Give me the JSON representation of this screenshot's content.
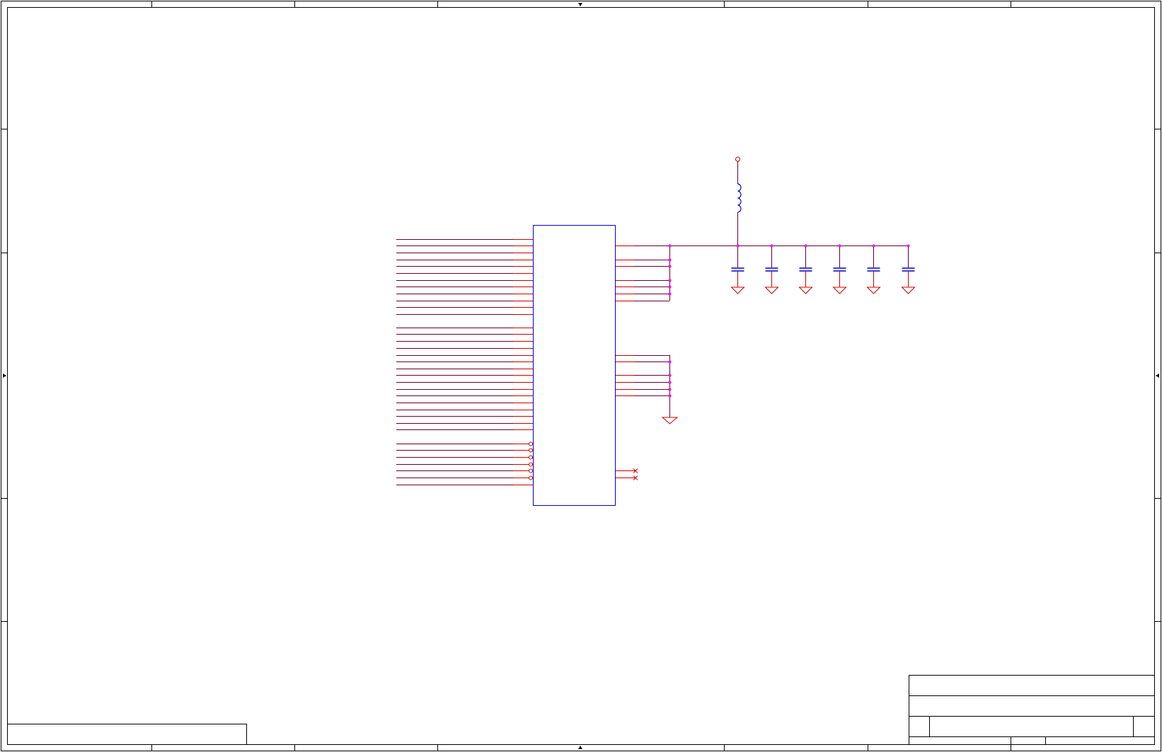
{
  "colors": {
    "frame": "#000000",
    "wire": "#cc0000",
    "bus_wire": "#660033",
    "component": "#0000cc",
    "junction": "#ff00ff",
    "power_port": "#cc0000"
  },
  "icons": {
    "ground": "ground-icon",
    "capacitor": "capacitor-icon",
    "inductor": "inductor-icon",
    "no_connect": "no-connect-icon",
    "power_port": "power-port-icon",
    "zone_arrow": "arrow-icon"
  },
  "schematic": {
    "left_net_count": 37,
    "decoupling_capacitor_count": 6,
    "no_connect_count": 2
  }
}
